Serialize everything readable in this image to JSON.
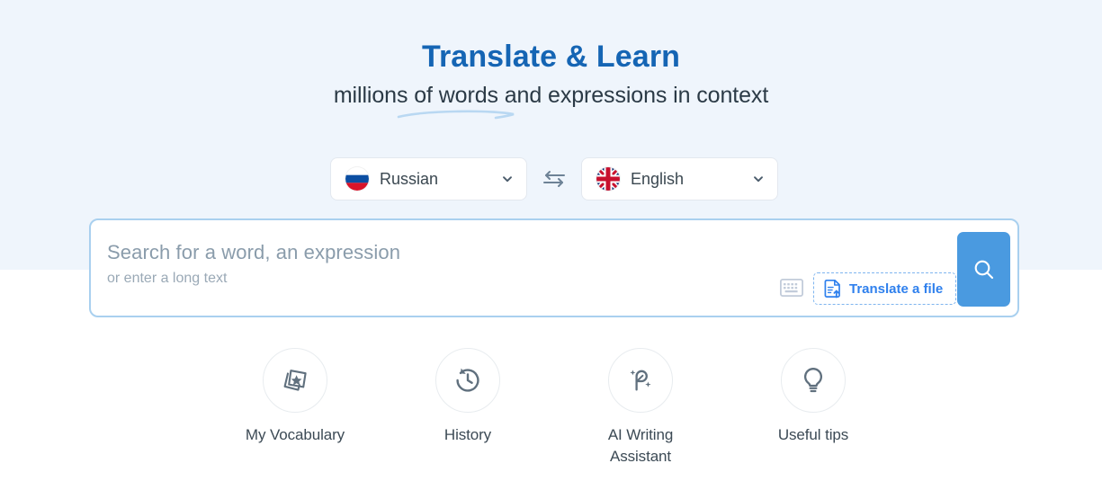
{
  "hero": {
    "title": "Translate & Learn",
    "subtitle_lead": "millions of words and expressions ",
    "subtitle_highlight": "in context"
  },
  "languages": {
    "source": {
      "name": "Russian",
      "flag": "russia-flag-icon"
    },
    "target": {
      "name": "English",
      "flag": "uk-flag-icon"
    },
    "swap_icon": "swap-arrows-icon",
    "chevron_icon": "chevron-down-icon"
  },
  "search": {
    "placeholder_main": "Search for a word, an expression",
    "placeholder_sub": "or enter a long text",
    "keyboard_icon": "virtual-keyboard-icon",
    "translate_file_label": "Translate a file",
    "translate_file_icon": "file-upload-icon",
    "search_icon": "search-icon",
    "value": ""
  },
  "quick_links": [
    {
      "label": "My Vocabulary",
      "icon": "flashcards-star-icon"
    },
    {
      "label": "History",
      "icon": "history-clock-icon"
    },
    {
      "label": "AI Writing Assistant",
      "icon": "feather-sparkle-icon"
    },
    {
      "label": "Useful tips",
      "icon": "lightbulb-icon"
    }
  ],
  "colors": {
    "band_top": "#eff5fc",
    "title_blue": "#1565b4",
    "accent_blue": "#2f80ed",
    "search_button": "#4a9ae0",
    "search_border": "#a9d0ef",
    "icon_gray": "#60707e"
  }
}
